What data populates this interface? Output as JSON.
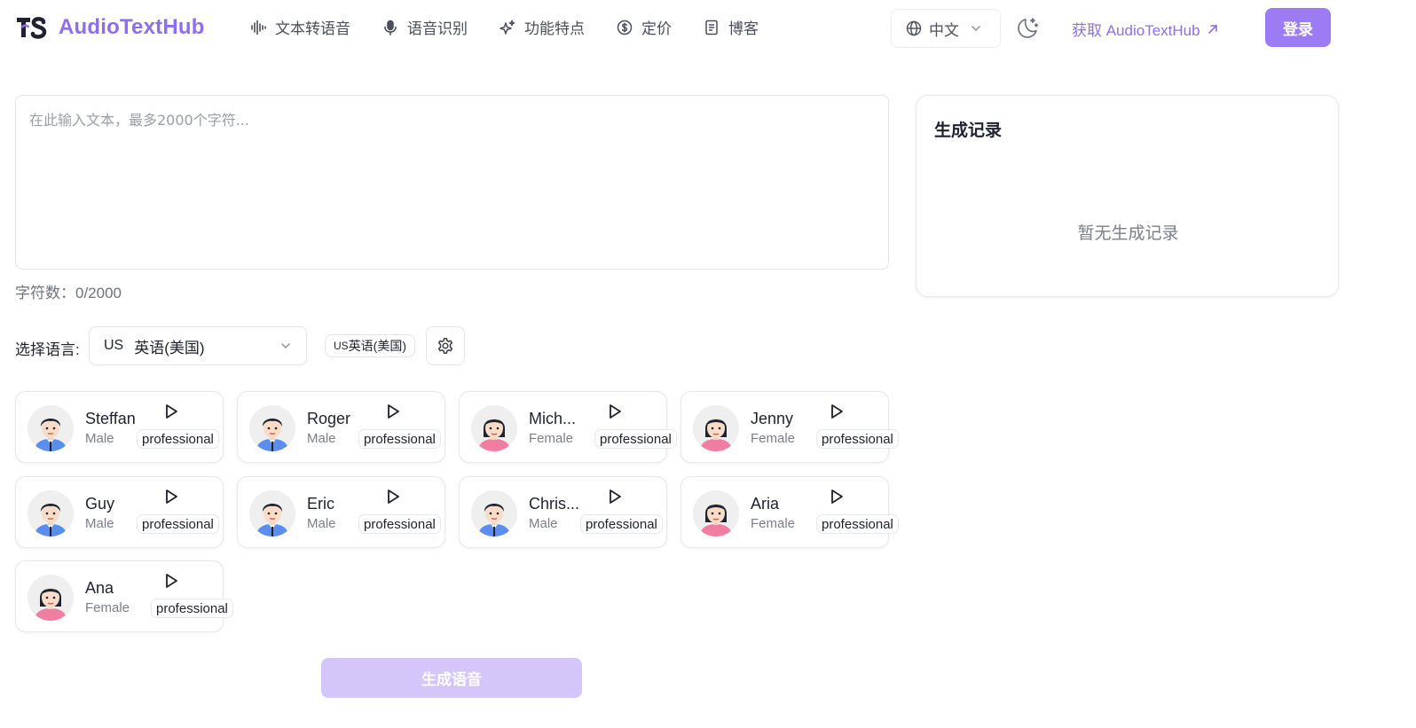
{
  "header": {
    "logo_mark": "TS",
    "brand": "AudioTextHub",
    "nav": [
      {
        "label": "文本转语音",
        "icon": "waveform-icon"
      },
      {
        "label": "语音识别",
        "icon": "microphone-icon"
      },
      {
        "label": "功能特点",
        "icon": "sparkles-icon"
      },
      {
        "label": "定价",
        "icon": "dollar-circle-icon"
      },
      {
        "label": "博客",
        "icon": "document-icon"
      }
    ],
    "language": "中文",
    "get_app_label": "获取 AudioTextHub",
    "login_label": "登录"
  },
  "editor": {
    "placeholder": "在此输入文本，最多2000个字符...",
    "value": "",
    "char_count": "字符数：0/2000"
  },
  "language_picker": {
    "label": "选择语言:",
    "selected_flag": "US",
    "selected_value": "英语(美国)",
    "tag_flag": "US",
    "tag_label": "英语(美国)"
  },
  "voices": [
    {
      "name": "Steffan",
      "gender": "Male",
      "tag": "professional"
    },
    {
      "name": "Roger",
      "gender": "Male",
      "tag": "professional"
    },
    {
      "name": "Mich...",
      "gender": "Female",
      "tag": "professional"
    },
    {
      "name": "Jenny",
      "gender": "Female",
      "tag": "professional"
    },
    {
      "name": "Guy",
      "gender": "Male",
      "tag": "professional"
    },
    {
      "name": "Eric",
      "gender": "Male",
      "tag": "professional"
    },
    {
      "name": "Chris...",
      "gender": "Male",
      "tag": "professional"
    },
    {
      "name": "Aria",
      "gender": "Female",
      "tag": "professional"
    },
    {
      "name": "Ana",
      "gender": "Female",
      "tag": "professional"
    }
  ],
  "generate_label": "生成语音",
  "history": {
    "title": "生成记录",
    "empty_text": "暂无生成记录"
  },
  "colors": {
    "brand": "#8f6df0",
    "login_bg": "#9b7cf2",
    "generate_disabled_bg": "#d4c6fb",
    "male_shirt": "#5b8def",
    "female_shirt": "#f07ea0"
  }
}
